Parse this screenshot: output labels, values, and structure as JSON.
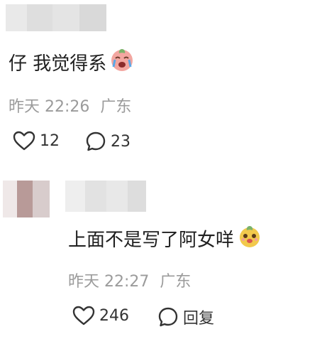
{
  "comments": [
    {
      "text": "仔 我觉得系",
      "emoji": "crying-face-emoji",
      "time": "昨天 22:26",
      "location": "广东",
      "likes": "12",
      "replies": "23"
    },
    {
      "text": "上面不是写了阿女咩",
      "emoji": "smiling-face-emoji",
      "time": "昨天 22:27",
      "location": "广东",
      "likes": "246",
      "reply_label": "回复"
    }
  ],
  "colors": {
    "text": "#1f1f1f",
    "meta": "#9b9b9b",
    "icon": "#333333"
  }
}
